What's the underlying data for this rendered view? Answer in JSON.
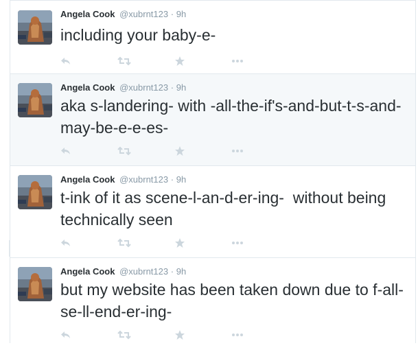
{
  "tweets": [
    {
      "fullname": "Angela Cook",
      "username": "@xubrnt123",
      "separator": "·",
      "time": "9h",
      "text": "including your baby-e-"
    },
    {
      "fullname": "Angela Cook",
      "username": "@xubrnt123",
      "separator": "·",
      "time": "9h",
      "text": "aka s-landering- with -all-the-if's-and-but-t-s-and-may-be-e-e-es-"
    },
    {
      "fullname": "Angela Cook",
      "username": "@xubrnt123",
      "separator": "·",
      "time": "9h",
      "text": "t-ink of it as scene-l-an-d-er-ing-  without being technically seen"
    },
    {
      "fullname": "Angela Cook",
      "username": "@xubrnt123",
      "separator": "·",
      "time": "9h",
      "text": "but my website has been taken down due to f-all-se-ll-end-er-ing-"
    }
  ],
  "icons": {
    "reply": "reply-icon",
    "retweet": "retweet-icon",
    "favorite": "star-icon",
    "more": "more-icon",
    "avatar": "avatar"
  },
  "colors": {
    "name": "#292f33",
    "meta": "#8899a6",
    "action_icon": "#ccd6dd",
    "hover_bg": "#f5f8fa",
    "border": "#e1e8ed"
  }
}
